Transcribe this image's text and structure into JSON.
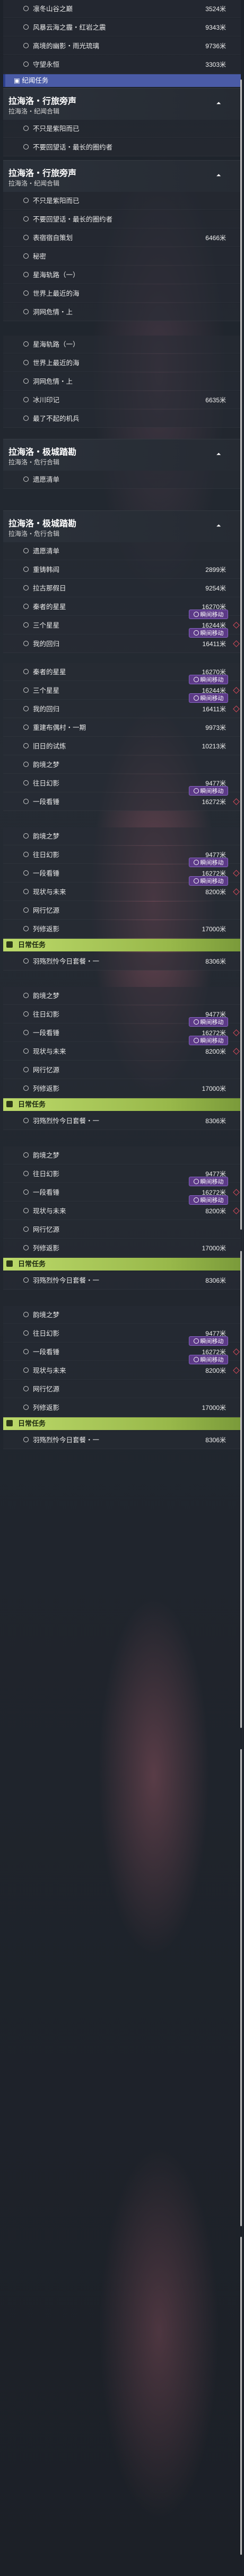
{
  "sections": {
    "s1_top_items": [
      {
        "name": "凛冬山谷之巅",
        "dist": "3524米"
      },
      {
        "name": "风暴云海之霾・红岩之震",
        "dist": "9343米"
      },
      {
        "name": "高境的幽影・雨光琉璃",
        "dist": "9736米"
      },
      {
        "name": "守望永恒",
        "dist": "3303米"
      }
    ],
    "collapsed_label": "纪闻任务",
    "section_a": {
      "title": "拉海洛・行旅旁声",
      "subtitle": "拉海洛・纪闻合辑"
    },
    "section_a_items": [
      {
        "name": "不只是紫阳而已",
        "dist": ""
      },
      {
        "name": "不要回望话・最长的圈约者",
        "dist": ""
      }
    ],
    "section_b": {
      "title": "拉海洛・行旅旁声",
      "subtitle": "拉海洛・纪闻合辑"
    },
    "section_b_items": [
      {
        "name": "不只是紫阳而已",
        "dist": ""
      },
      {
        "name": "不要回望话・最长的圈约者",
        "dist": ""
      },
      {
        "name": "表宿宿自策划",
        "dist": "6466米"
      },
      {
        "name": "秘密",
        "dist": ""
      },
      {
        "name": "星海轨路（一）",
        "dist": ""
      },
      {
        "name": "世界上最近的海",
        "dist": ""
      },
      {
        "name": "洞网危情・上",
        "dist": ""
      }
    ],
    "section_b_items2": [
      {
        "name": "星海轨路（一）",
        "dist": ""
      },
      {
        "name": "世界上最近的海",
        "dist": ""
      },
      {
        "name": "洞网危情・上",
        "dist": ""
      },
      {
        "name": "冰川印记",
        "dist": "6635米"
      },
      {
        "name": "最了不起的机兵",
        "dist": ""
      }
    ],
    "section_c": {
      "title": "拉海洛・极城踏勘",
      "subtitle": "拉海洛・危行合辑"
    },
    "section_c_items": [
      {
        "name": "遗愿清单",
        "dist": ""
      }
    ],
    "section_d": {
      "title": "拉海洛・极城踏勘",
      "subtitle": "拉海洛・危行合辑"
    },
    "section_d_items": [
      {
        "name": "遗愿清单",
        "dist": ""
      },
      {
        "name": "重铸韩阎",
        "dist": "2899米"
      },
      {
        "name": "拉古那假日",
        "dist": "9254米"
      },
      {
        "name": "秦者的星星",
        "dist": "16270米"
      },
      {
        "name": "三个星星",
        "dist": "16244米",
        "badge": true
      },
      {
        "name": "我的回归",
        "dist": "16411米",
        "badge": true
      }
    ],
    "section_e_items": [
      {
        "name": "秦者的星星",
        "dist": "16270米"
      },
      {
        "name": "三个星星",
        "dist": "16244米",
        "badge": true
      },
      {
        "name": "我的回归",
        "dist": "16411米",
        "badge": true
      },
      {
        "name": "重建布偶村・一期",
        "dist": "9973米"
      },
      {
        "name": "旧日的试炼",
        "dist": "10213米"
      },
      {
        "name": "featured_dream",
        "dist": ""
      },
      {
        "name": "往日幻影",
        "dist": "9477米"
      },
      {
        "name": "一段看锤",
        "dist": "16272米",
        "badge": true
      }
    ],
    "loop_blocks": [
      [
        {
          "name": "featured_dream",
          "dist": ""
        },
        {
          "name": "往日幻影",
          "dist": "9477米"
        },
        {
          "name": "一段看锤",
          "dist": "16272米",
          "badge": true
        },
        {
          "name": "现状与未来",
          "dist": "8200米",
          "badge": true
        },
        {
          "name": "网行忆源",
          "dist": ""
        },
        {
          "name": "列修返影",
          "dist": "17000米"
        }
      ]
    ],
    "daily": {
      "label": "日常任务",
      "item": "羽殇烈怜今日套餐・一",
      "dist": "8306米"
    }
  },
  "badge_label": "瞬间移动",
  "dream_label": "韵境之梦",
  "colors": {
    "badge": "#5c3a87",
    "daily": "#a9c85a",
    "gem": "#d84a5a",
    "collapsed": "#4a5ba6"
  }
}
